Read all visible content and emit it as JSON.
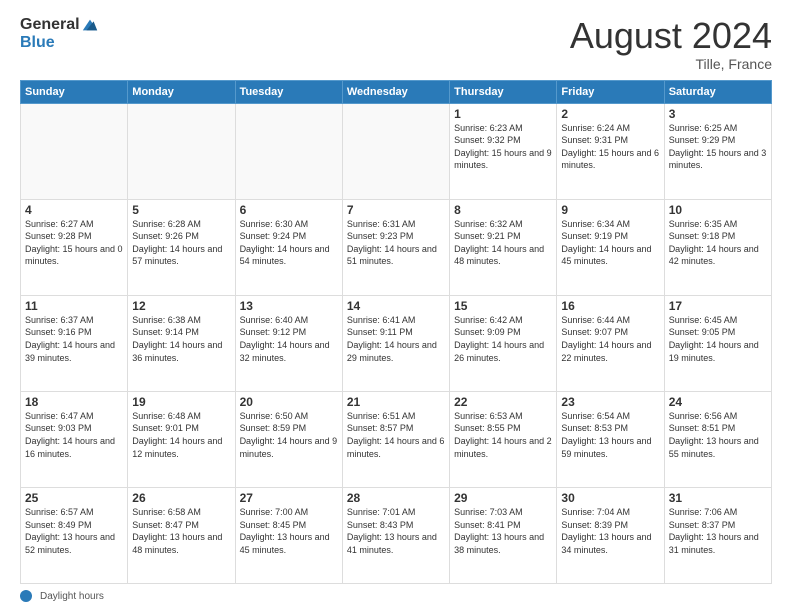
{
  "header": {
    "logo_general": "General",
    "logo_blue": "Blue",
    "month": "August 2024",
    "location": "Tille, France"
  },
  "footer": {
    "label": "Daylight hours"
  },
  "weekdays": [
    "Sunday",
    "Monday",
    "Tuesday",
    "Wednesday",
    "Thursday",
    "Friday",
    "Saturday"
  ],
  "weeks": [
    [
      {
        "day": "",
        "sunrise": "",
        "sunset": "",
        "daylight": "",
        "empty": true
      },
      {
        "day": "",
        "sunrise": "",
        "sunset": "",
        "daylight": "",
        "empty": true
      },
      {
        "day": "",
        "sunrise": "",
        "sunset": "",
        "daylight": "",
        "empty": true
      },
      {
        "day": "",
        "sunrise": "",
        "sunset": "",
        "daylight": "",
        "empty": true
      },
      {
        "day": "1",
        "sunrise": "Sunrise: 6:23 AM",
        "sunset": "Sunset: 9:32 PM",
        "daylight": "Daylight: 15 hours and 9 minutes.",
        "empty": false
      },
      {
        "day": "2",
        "sunrise": "Sunrise: 6:24 AM",
        "sunset": "Sunset: 9:31 PM",
        "daylight": "Daylight: 15 hours and 6 minutes.",
        "empty": false
      },
      {
        "day": "3",
        "sunrise": "Sunrise: 6:25 AM",
        "sunset": "Sunset: 9:29 PM",
        "daylight": "Daylight: 15 hours and 3 minutes.",
        "empty": false
      }
    ],
    [
      {
        "day": "4",
        "sunrise": "Sunrise: 6:27 AM",
        "sunset": "Sunset: 9:28 PM",
        "daylight": "Daylight: 15 hours and 0 minutes.",
        "empty": false
      },
      {
        "day": "5",
        "sunrise": "Sunrise: 6:28 AM",
        "sunset": "Sunset: 9:26 PM",
        "daylight": "Daylight: 14 hours and 57 minutes.",
        "empty": false
      },
      {
        "day": "6",
        "sunrise": "Sunrise: 6:30 AM",
        "sunset": "Sunset: 9:24 PM",
        "daylight": "Daylight: 14 hours and 54 minutes.",
        "empty": false
      },
      {
        "day": "7",
        "sunrise": "Sunrise: 6:31 AM",
        "sunset": "Sunset: 9:23 PM",
        "daylight": "Daylight: 14 hours and 51 minutes.",
        "empty": false
      },
      {
        "day": "8",
        "sunrise": "Sunrise: 6:32 AM",
        "sunset": "Sunset: 9:21 PM",
        "daylight": "Daylight: 14 hours and 48 minutes.",
        "empty": false
      },
      {
        "day": "9",
        "sunrise": "Sunrise: 6:34 AM",
        "sunset": "Sunset: 9:19 PM",
        "daylight": "Daylight: 14 hours and 45 minutes.",
        "empty": false
      },
      {
        "day": "10",
        "sunrise": "Sunrise: 6:35 AM",
        "sunset": "Sunset: 9:18 PM",
        "daylight": "Daylight: 14 hours and 42 minutes.",
        "empty": false
      }
    ],
    [
      {
        "day": "11",
        "sunrise": "Sunrise: 6:37 AM",
        "sunset": "Sunset: 9:16 PM",
        "daylight": "Daylight: 14 hours and 39 minutes.",
        "empty": false
      },
      {
        "day": "12",
        "sunrise": "Sunrise: 6:38 AM",
        "sunset": "Sunset: 9:14 PM",
        "daylight": "Daylight: 14 hours and 36 minutes.",
        "empty": false
      },
      {
        "day": "13",
        "sunrise": "Sunrise: 6:40 AM",
        "sunset": "Sunset: 9:12 PM",
        "daylight": "Daylight: 14 hours and 32 minutes.",
        "empty": false
      },
      {
        "day": "14",
        "sunrise": "Sunrise: 6:41 AM",
        "sunset": "Sunset: 9:11 PM",
        "daylight": "Daylight: 14 hours and 29 minutes.",
        "empty": false
      },
      {
        "day": "15",
        "sunrise": "Sunrise: 6:42 AM",
        "sunset": "Sunset: 9:09 PM",
        "daylight": "Daylight: 14 hours and 26 minutes.",
        "empty": false
      },
      {
        "day": "16",
        "sunrise": "Sunrise: 6:44 AM",
        "sunset": "Sunset: 9:07 PM",
        "daylight": "Daylight: 14 hours and 22 minutes.",
        "empty": false
      },
      {
        "day": "17",
        "sunrise": "Sunrise: 6:45 AM",
        "sunset": "Sunset: 9:05 PM",
        "daylight": "Daylight: 14 hours and 19 minutes.",
        "empty": false
      }
    ],
    [
      {
        "day": "18",
        "sunrise": "Sunrise: 6:47 AM",
        "sunset": "Sunset: 9:03 PM",
        "daylight": "Daylight: 14 hours and 16 minutes.",
        "empty": false
      },
      {
        "day": "19",
        "sunrise": "Sunrise: 6:48 AM",
        "sunset": "Sunset: 9:01 PM",
        "daylight": "Daylight: 14 hours and 12 minutes.",
        "empty": false
      },
      {
        "day": "20",
        "sunrise": "Sunrise: 6:50 AM",
        "sunset": "Sunset: 8:59 PM",
        "daylight": "Daylight: 14 hours and 9 minutes.",
        "empty": false
      },
      {
        "day": "21",
        "sunrise": "Sunrise: 6:51 AM",
        "sunset": "Sunset: 8:57 PM",
        "daylight": "Daylight: 14 hours and 6 minutes.",
        "empty": false
      },
      {
        "day": "22",
        "sunrise": "Sunrise: 6:53 AM",
        "sunset": "Sunset: 8:55 PM",
        "daylight": "Daylight: 14 hours and 2 minutes.",
        "empty": false
      },
      {
        "day": "23",
        "sunrise": "Sunrise: 6:54 AM",
        "sunset": "Sunset: 8:53 PM",
        "daylight": "Daylight: 13 hours and 59 minutes.",
        "empty": false
      },
      {
        "day": "24",
        "sunrise": "Sunrise: 6:56 AM",
        "sunset": "Sunset: 8:51 PM",
        "daylight": "Daylight: 13 hours and 55 minutes.",
        "empty": false
      }
    ],
    [
      {
        "day": "25",
        "sunrise": "Sunrise: 6:57 AM",
        "sunset": "Sunset: 8:49 PM",
        "daylight": "Daylight: 13 hours and 52 minutes.",
        "empty": false
      },
      {
        "day": "26",
        "sunrise": "Sunrise: 6:58 AM",
        "sunset": "Sunset: 8:47 PM",
        "daylight": "Daylight: 13 hours and 48 minutes.",
        "empty": false
      },
      {
        "day": "27",
        "sunrise": "Sunrise: 7:00 AM",
        "sunset": "Sunset: 8:45 PM",
        "daylight": "Daylight: 13 hours and 45 minutes.",
        "empty": false
      },
      {
        "day": "28",
        "sunrise": "Sunrise: 7:01 AM",
        "sunset": "Sunset: 8:43 PM",
        "daylight": "Daylight: 13 hours and 41 minutes.",
        "empty": false
      },
      {
        "day": "29",
        "sunrise": "Sunrise: 7:03 AM",
        "sunset": "Sunset: 8:41 PM",
        "daylight": "Daylight: 13 hours and 38 minutes.",
        "empty": false
      },
      {
        "day": "30",
        "sunrise": "Sunrise: 7:04 AM",
        "sunset": "Sunset: 8:39 PM",
        "daylight": "Daylight: 13 hours and 34 minutes.",
        "empty": false
      },
      {
        "day": "31",
        "sunrise": "Sunrise: 7:06 AM",
        "sunset": "Sunset: 8:37 PM",
        "daylight": "Daylight: 13 hours and 31 minutes.",
        "empty": false
      }
    ]
  ]
}
